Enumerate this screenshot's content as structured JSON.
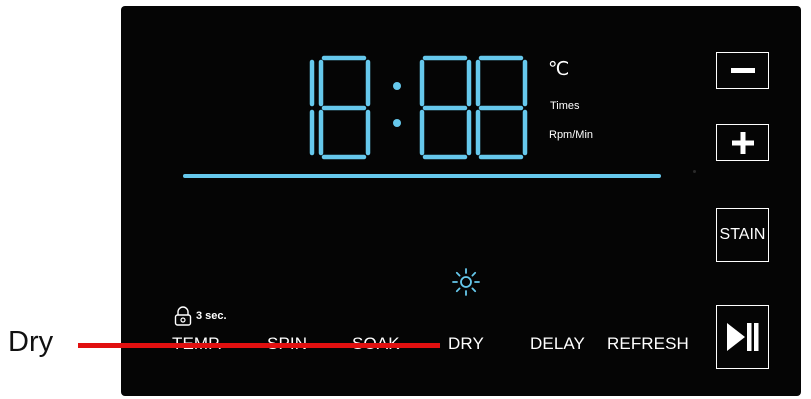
{
  "callout": {
    "label": "Dry",
    "color": "#e11010"
  },
  "display": {
    "digits": "18:88",
    "color": "#66c8ec",
    "units": {
      "celsius": "℃",
      "times": "Times",
      "rpm": "Rpm/Min"
    }
  },
  "buttons": {
    "minus": {
      "label": "−",
      "icon": "minus-icon"
    },
    "plus": {
      "label": "+",
      "icon": "plus-icon"
    },
    "stain": {
      "label": "STAIN"
    },
    "play_pause": {
      "icon": "play-pause-icon"
    }
  },
  "child_lock": {
    "label": "3 sec.",
    "icon": "lock-icon"
  },
  "dry_indicator": {
    "icon": "sun-icon"
  },
  "functions": [
    {
      "label": "TEMP."
    },
    {
      "label": "SPIN"
    },
    {
      "label": "SOAK"
    },
    {
      "label": "DRY"
    },
    {
      "label": "DELAY"
    },
    {
      "label": "REFRESH"
    }
  ],
  "colors": {
    "panel": "#050505",
    "accent": "#66c8ec",
    "text": "#ffffff"
  }
}
